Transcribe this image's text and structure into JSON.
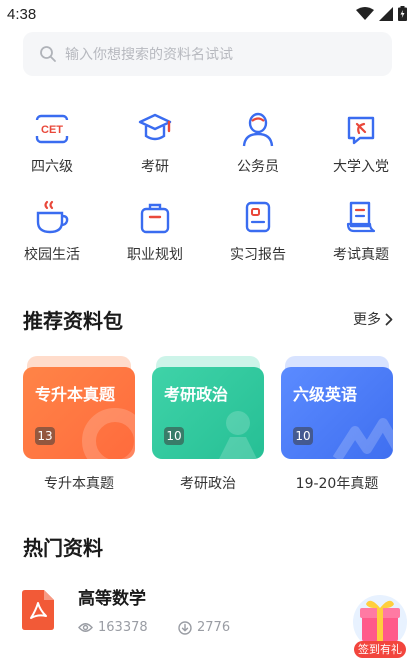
{
  "status": {
    "time": "4:38"
  },
  "search": {
    "placeholder": "输入你想搜索的资料名试试"
  },
  "categories": [
    {
      "label": "四六级",
      "icon": "cet-icon"
    },
    {
      "label": "考研",
      "icon": "graduation-cap-icon"
    },
    {
      "label": "公务员",
      "icon": "civil-servant-icon"
    },
    {
      "label": "大学入党",
      "icon": "party-flag-icon"
    },
    {
      "label": "校园生活",
      "icon": "coffee-cup-icon"
    },
    {
      "label": "职业规划",
      "icon": "briefcase-icon"
    },
    {
      "label": "实习报告",
      "icon": "id-card-icon"
    },
    {
      "label": "考试真题",
      "icon": "exam-paper-icon"
    }
  ],
  "cet_badge": "CET",
  "recommend": {
    "title": "推荐资料包",
    "more": "更多",
    "packs": [
      {
        "title": "专升本真题",
        "count": "13",
        "caption": "专升本真题",
        "color": "#ff7a3d"
      },
      {
        "title": "考研政治",
        "count": "10",
        "caption": "考研政治",
        "color": "#2fc7a0"
      },
      {
        "title": "六级英语",
        "count": "10",
        "caption": "19-20年真题",
        "color": "#4d7df5"
      }
    ]
  },
  "hot": {
    "title": "热门资料",
    "items": [
      {
        "title": "高等数学",
        "views": "163378",
        "downloads": "2776"
      }
    ]
  },
  "gift": {
    "label": "签到有礼"
  },
  "colors": {
    "accent": "#3a6cf0",
    "pdf": "#f25a37"
  }
}
